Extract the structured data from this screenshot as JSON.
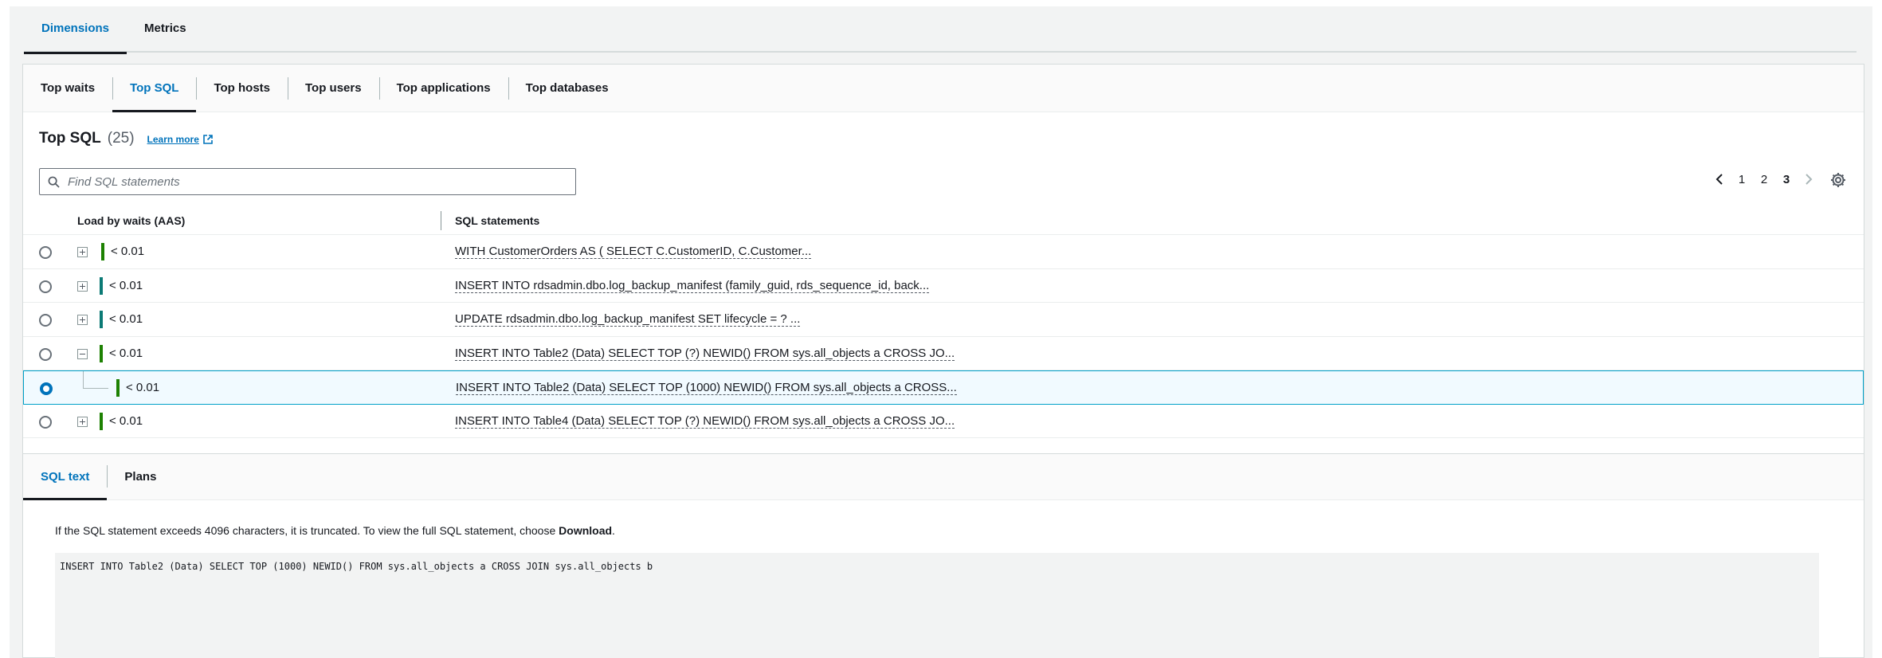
{
  "top_tabs": [
    {
      "label": "Dimensions",
      "active": true
    },
    {
      "label": "Metrics",
      "active": false
    }
  ],
  "sub_tabs": [
    {
      "label": "Top waits",
      "active": false
    },
    {
      "label": "Top SQL",
      "active": true
    },
    {
      "label": "Top hosts",
      "active": false
    },
    {
      "label": "Top users",
      "active": false
    },
    {
      "label": "Top applications",
      "active": false
    },
    {
      "label": "Top databases",
      "active": false
    }
  ],
  "section": {
    "title": "Top SQL",
    "count": "(25)",
    "learn_more": "Learn more"
  },
  "search": {
    "placeholder": "Find SQL statements",
    "value": ""
  },
  "pagination": {
    "pages": [
      "1",
      "2",
      "3"
    ],
    "current": "3"
  },
  "table": {
    "columns": {
      "load": "Load by waits (AAS)",
      "sql": "SQL statements"
    },
    "rows": [
      {
        "load": "< 0.01",
        "sql": "WITH CustomerOrders AS ( SELECT C.CustomerID, C.Customer...",
        "selected": false,
        "expander": "plus",
        "bar_color": "#1d8102",
        "child": false
      },
      {
        "load": "< 0.01",
        "sql": "INSERT INTO rdsadmin.dbo.log_backup_manifest (family_guid, rds_sequence_id, back...",
        "selected": false,
        "expander": "plus",
        "bar_color": "#0b7a75",
        "child": false
      },
      {
        "load": "< 0.01",
        "sql": "UPDATE rdsadmin.dbo.log_backup_manifest SET lifecycle = ? ...",
        "selected": false,
        "expander": "plus",
        "bar_color": "#0b7a75",
        "child": false
      },
      {
        "load": "< 0.01",
        "sql": "INSERT INTO Table2 (Data) SELECT TOP (?) NEWID() FROM sys.all_objects a CROSS JO...",
        "selected": false,
        "expander": "minus",
        "bar_color": "#1d8102",
        "child": false
      },
      {
        "load": "< 0.01",
        "sql": "INSERT INTO Table2 (Data) SELECT TOP (1000) NEWID() FROM sys.all_objects a CROSS...",
        "selected": true,
        "expander": "none",
        "bar_color": "#1d8102",
        "child": true
      },
      {
        "load": "< 0.01",
        "sql": "INSERT INTO Table4 (Data) SELECT TOP (?) NEWID() FROM sys.all_objects a CROSS JO...",
        "selected": false,
        "expander": "plus",
        "bar_color": "#1d8102",
        "child": false
      }
    ]
  },
  "bottom_tabs": [
    {
      "label": "SQL text",
      "active": true
    },
    {
      "label": "Plans",
      "active": false
    }
  ],
  "notice": {
    "text": "If the SQL statement exceeds 4096 characters, it is truncated. To view the full SQL statement, choose ",
    "bold": "Download",
    "end": "."
  },
  "sql_text": "INSERT INTO Table2 (Data) SELECT TOP (1000) NEWID() FROM sys.all_objects a CROSS JOIN sys.all_objects b",
  "icons": {
    "search": "search-icon",
    "external": "external-link-icon",
    "prev": "chevron-left-icon",
    "next": "chevron-right-icon",
    "settings": "gear-icon"
  }
}
